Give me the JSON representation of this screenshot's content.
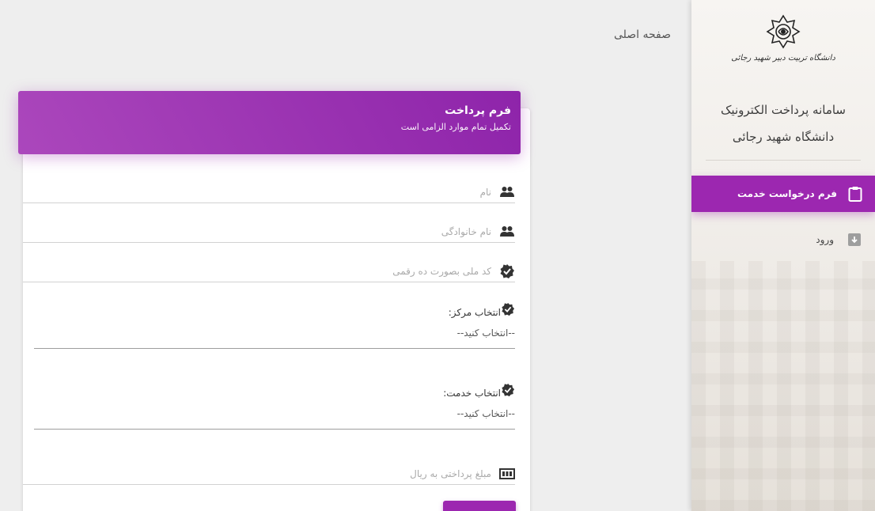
{
  "sidebar": {
    "logo_caption": "دانشگاه تربیت دبیر شهید رجائی",
    "system_title_line1": "سامانه پرداخت الکترونیک",
    "system_title_line2": "دانشگاه شهید رجائی",
    "items": [
      {
        "label": "فرم درخواست خدمت",
        "icon": "clipboard-icon",
        "active": true
      },
      {
        "label": "ورود",
        "icon": "login-icon",
        "active": false
      }
    ]
  },
  "breadcrumb": "صفحه اصلی",
  "form": {
    "title": "فرم پرداخت",
    "subtitle": "تکمیل تمام موارد الزامی است",
    "first_name_placeholder": "نام",
    "last_name_placeholder": "نام خانوادگی",
    "national_id_placeholder": "کد ملی بصورت ده رقمی",
    "center_label": "انتخاب مرکز:",
    "center_value": "--انتخاب کنید--",
    "service_label": "انتخاب خدمت:",
    "service_value": "--انتخاب کنید--",
    "amount_placeholder": "مبلغ پرداختی به ریال"
  },
  "colors": {
    "accent": "#9c27b0",
    "header_gradient_start": "#ab47bc",
    "header_gradient_end": "#8e24aa"
  }
}
